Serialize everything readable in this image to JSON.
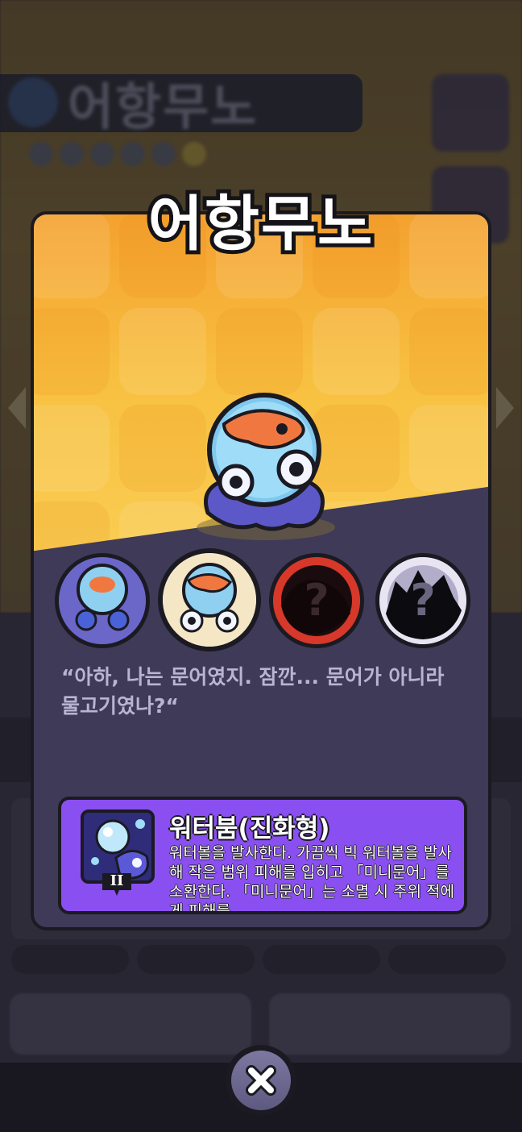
{
  "background": {
    "title": "어항무노"
  },
  "modal": {
    "title": "어항무노",
    "quote": "“아하, 나는 문어였지. 잠깐... 문어가 아니라 물고기였나?“",
    "evolutions": [
      {
        "name": "stage-1",
        "locked": false,
        "selected": false
      },
      {
        "name": "stage-2",
        "locked": false,
        "selected": true
      },
      {
        "name": "stage-3",
        "locked": true,
        "selected": false,
        "mark": "?"
      },
      {
        "name": "stage-4",
        "locked": true,
        "selected": false,
        "mark": "?"
      }
    ],
    "skill": {
      "name": "워터붐(진화형)",
      "description": "워터볼을 발사한다. 가끔씩 빅 워터볼을 발사해 작은 범위 피해를 입히고 「미니문어」를 소환한다. 「미니문어」는 소멸 시 주위 적에게 피해를",
      "level": "II",
      "icon": "water-bubble-octopus-icon"
    },
    "close_icon": "close-x-icon"
  },
  "colors": {
    "header_orange": "#f4a12f",
    "header_yellow": "#fad25a",
    "card_body": "#3e3a57",
    "skill_purple": "#8a4ff0",
    "outline": "#1b1a22"
  }
}
